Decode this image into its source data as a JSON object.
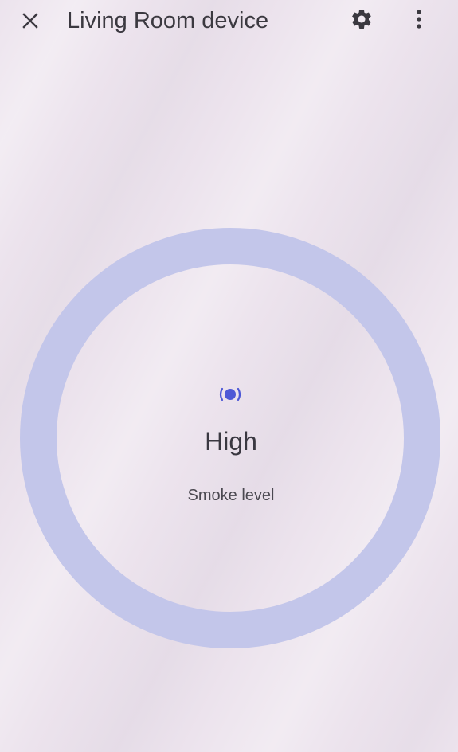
{
  "app_bar": {
    "title": "Living Room device",
    "close_icon": "close-icon",
    "settings_icon": "gear-icon",
    "more_icon": "more-vert-icon"
  },
  "sensor": {
    "status_icon": "smoke-sensor-icon",
    "value": "High",
    "label": "Smoke level"
  },
  "colors": {
    "background": "#ece3ed",
    "ring": "#c3c6ea",
    "accent": "#4d58d6",
    "text_primary": "#3a3841",
    "text_secondary": "#4a4850"
  }
}
